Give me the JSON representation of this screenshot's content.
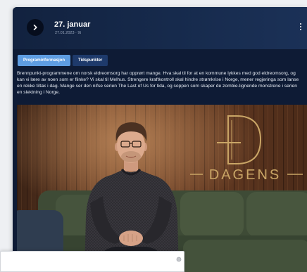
{
  "colors": {
    "page_bg": "#eef0f3",
    "panel_bg": "#0e1b35",
    "active_tab": "#5e9de2",
    "inactive_tab": "#1e3a6b",
    "logo_gold": "#c9a566"
  },
  "icons": {
    "play": "chevron-right-icon",
    "menu": "more-vertical-icon",
    "input": "circle-icon"
  },
  "program": {
    "title": "27. januar",
    "subtitle": "27.01.2023 · 9t"
  },
  "tabs": [
    {
      "label": "Programinformasjon",
      "active": true
    },
    {
      "label": "Tidspunkter",
      "active": false
    }
  ],
  "description": {
    "lines": [
      "Brennpunkt-programmene om norsk eldreomsorg har opprørt mange. Hva skal til for at en kommune lykkes med god eldreomsorg, og",
      "kan vi lære av noen som er flinke? Vi skal til Melhus. Strengere kraftkontroll skal hindre strømkrise i Norge, mener regjeringa som lanse",
      "en rekke tiltak i dag. Mange ser den nifse serien The Last of Us for tida, og soppen som skaper de zombie-lignende monstrene i serien",
      "en slektning i Norge."
    ]
  },
  "image": {
    "logo_text": "DAGENS"
  },
  "input": {
    "value": ""
  }
}
